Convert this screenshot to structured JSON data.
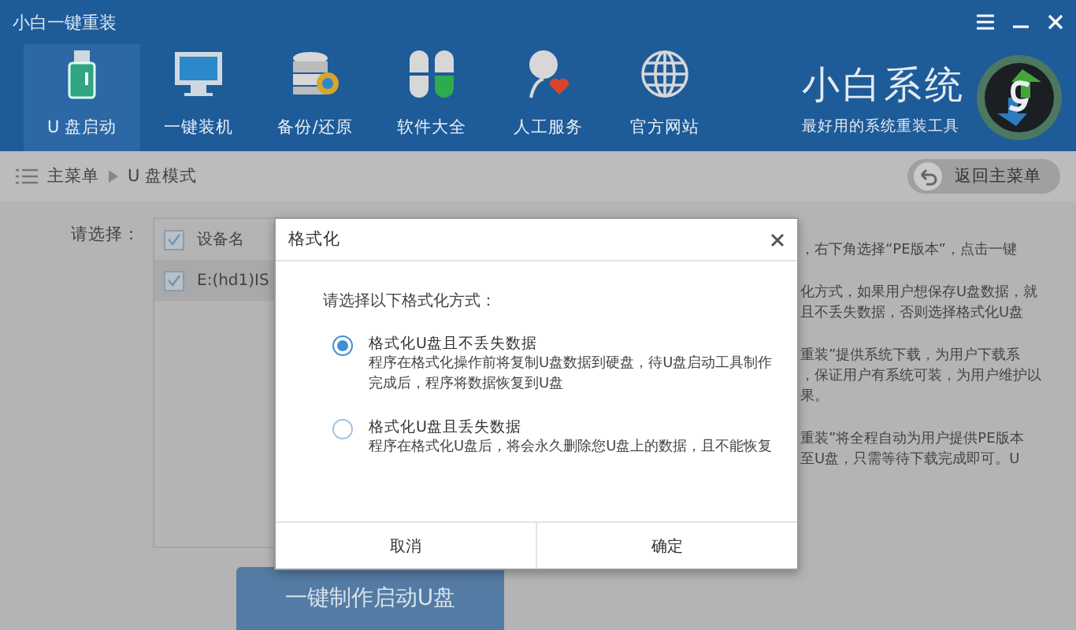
{
  "window": {
    "title": "小白一键重装"
  },
  "nav": [
    {
      "label": "U 盘启动",
      "kind": "usb",
      "selected": true
    },
    {
      "label": "一键装机",
      "kind": "monitor",
      "selected": false
    },
    {
      "label": "备份/还原",
      "kind": "database",
      "selected": false
    },
    {
      "label": "软件大全",
      "kind": "clover",
      "selected": false
    },
    {
      "label": "人工服务",
      "kind": "person",
      "selected": false
    },
    {
      "label": "官方网站",
      "kind": "globe",
      "selected": false
    }
  ],
  "brand": {
    "name": "小白系统",
    "tagline": "最好用的系统重装工具"
  },
  "breadcrumb": {
    "items": [
      "主菜单",
      "U 盘模式"
    ],
    "back_button": "返回主菜单"
  },
  "select_label": "请选择：",
  "device_table": {
    "header_checked": true,
    "column": "设备名",
    "rows": [
      {
        "name": "E:(hd1)IS",
        "checked": true
      }
    ]
  },
  "notes": [
    [
      "，右下角选择“PE版本”，点击一键"
    ],
    [
      "化方式，如果用户想保存U盘数据，就",
      "且不丢失数据，否则选择格式化U盘"
    ],
    [
      "重装”提供系统下载，为用户下载系",
      "，保证用户有系统可装，为用户维护以",
      "果。"
    ],
    [
      "重装”将全程自动为用户提供PE版本",
      "至U盘，只需等待下载完成即可。U"
    ]
  ],
  "make_button": "一键制作启动U盘",
  "dialog": {
    "title": "格式化",
    "prompt": "请选择以下格式化方式：",
    "options": [
      {
        "title": "格式化U盘且不丢失数据",
        "description": "程序在格式化操作前将复制U盘数据到硬盘，待U盘启动工具制作完成后，程序将数据恢复到U盘",
        "selected": true
      },
      {
        "title": "格式化U盘且丢失数据",
        "description": "程序在格式化U盘后，将会永久删除您U盘上的数据，且不能恢复",
        "selected": false
      }
    ],
    "buttons": [
      "取消",
      "确定"
    ]
  }
}
